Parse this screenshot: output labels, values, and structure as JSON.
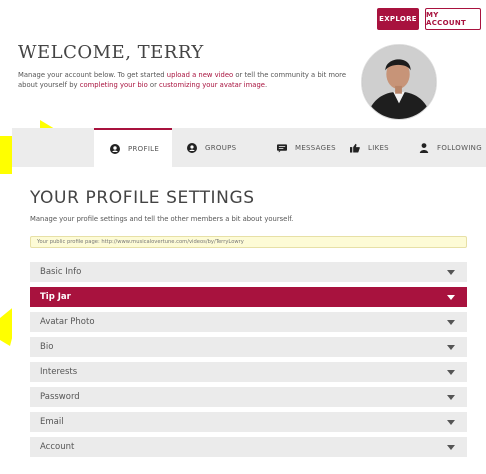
{
  "header": {
    "explore_label": "EXPLORE",
    "account_label": "MY ACCOUNT",
    "welcome": "WELCOME, TERRY",
    "intro": {
      "t1": "Manage your account below. To get started ",
      "l1": "upload a new video",
      "t2": " or tell the community a bit more about yourself by ",
      "l2": "completing your bio",
      "t3": " or ",
      "l3": "customizing your avatar image",
      "t4": "."
    }
  },
  "tabs": [
    {
      "label": "PROFILE",
      "icon": "user-circle-icon",
      "active": true
    },
    {
      "label": "GROUPS",
      "icon": "group-circle-icon",
      "active": false
    },
    {
      "label": "MESSAGES",
      "icon": "messages-icon",
      "active": false
    },
    {
      "label": "LIKES",
      "icon": "thumbs-up-icon",
      "active": false
    },
    {
      "label": "FOLLOWING",
      "icon": "person-icon",
      "active": false
    }
  ],
  "settings": {
    "title": "YOUR PROFILE SETTINGS",
    "description": "Manage your profile settings and tell the other members a bit about yourself.",
    "public_page": "Your public profile page: http://www.musicalovertune.com/videos/by/TerryLowry"
  },
  "sections": [
    {
      "label": "Basic Info",
      "active": false
    },
    {
      "label": "Tip Jar",
      "active": true
    },
    {
      "label": "Avatar Photo",
      "active": false
    },
    {
      "label": "Bio",
      "active": false
    },
    {
      "label": "Interests",
      "active": false
    },
    {
      "label": "Password",
      "active": false
    },
    {
      "label": "Email",
      "active": false
    },
    {
      "label": "Account",
      "active": false
    }
  ],
  "colors": {
    "accent": "#a8123e",
    "annotation_arrow": "#ffff00",
    "tab_bar": "#ececec",
    "accordion": "#ebebeb",
    "notice_bg": "#fdfbd6"
  }
}
